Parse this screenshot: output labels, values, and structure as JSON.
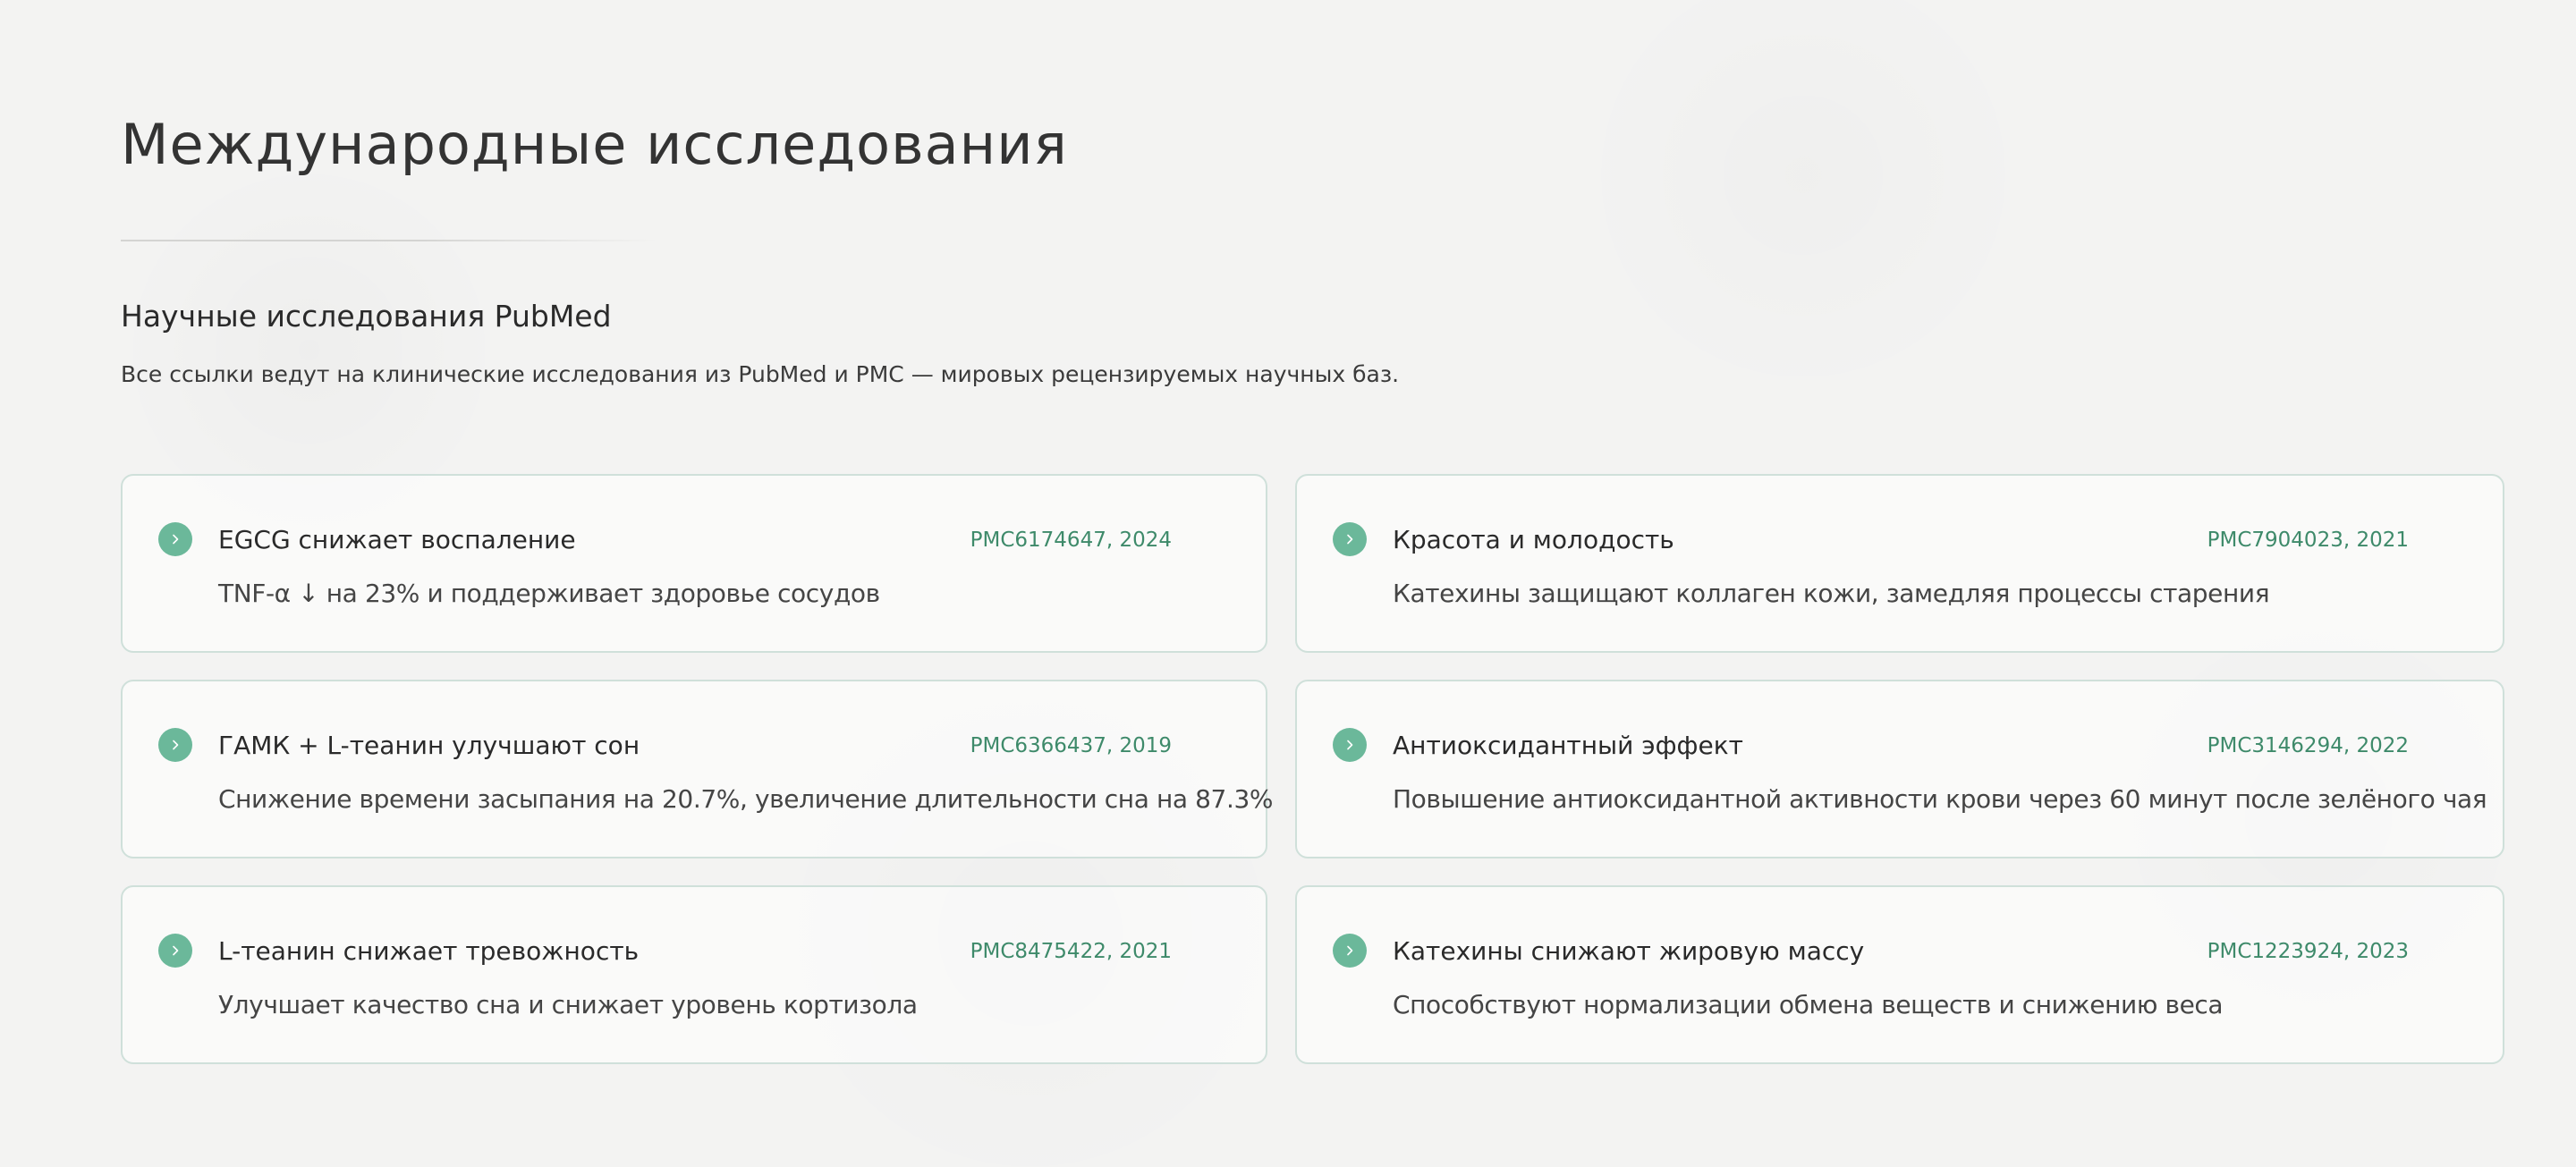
{
  "header": {
    "title": "Международные исследования"
  },
  "section": {
    "title": "Научные исследования PubMed",
    "description": "Все ссылки ведут на клинические исследования из PubMed и PMC — мировых рецензируемых научных баз."
  },
  "studies": [
    {
      "title": "EGCG снижает воспаление",
      "ref": "PMC6174647, 2024",
      "description": "TNF-α ↓ на 23% и поддерживает здоровье сосудов"
    },
    {
      "title": "Красота и молодость",
      "ref": "PMC7904023, 2021",
      "description": "Катехины защищают коллаген кожи, замедляя процессы старения"
    },
    {
      "title": "ГАМК + L-теанин улучшают сон",
      "ref": "PMC6366437, 2019",
      "description": "Снижение времени засыпания на 20.7%, увеличение длительности сна на 87.3%"
    },
    {
      "title": "Антиоксидантный эффект",
      "ref": "PMC3146294, 2022",
      "description": "Повышение антиоксидантной активности крови через 60 минут после зелёного чая"
    },
    {
      "title": "L-теанин снижает тревожность",
      "ref": "PMC8475422, 2021",
      "description": "Улучшает качество сна и снижает уровень кортизола"
    },
    {
      "title": "Катехины снижают жировую массу",
      "ref": "PMC1223924, 2023",
      "description": "Способствуют нормализации обмена веществ и снижению веса"
    }
  ],
  "icons": {
    "card_icon": "chevron-right-icon"
  },
  "colors": {
    "accent": "#6bb89a",
    "ref_text": "#3e8a6a",
    "card_border": "#cfe0da",
    "background": "#f3f3f2"
  }
}
